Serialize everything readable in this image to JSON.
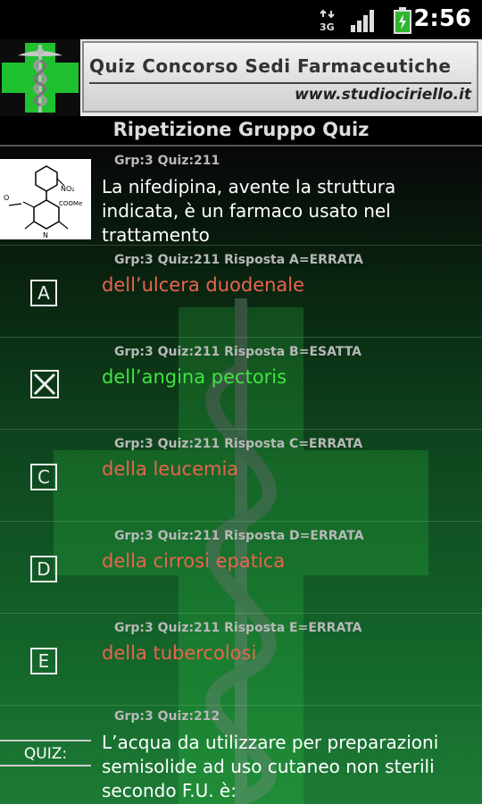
{
  "status_bar": {
    "time": "2:56",
    "network_label": "3G",
    "icons": [
      "3g-data-icon",
      "signal-icon",
      "battery-charging-icon"
    ]
  },
  "banner": {
    "title": "Quiz Concorso Sedi Farmaceutiche",
    "website": "www.studiociriello.it",
    "logo": "pharmacy-cross-caduceus-logo"
  },
  "header": {
    "title": "Ripetizione Gruppo Quiz"
  },
  "question_1": {
    "meta": "Grp:3  Quiz:211",
    "text": "La nifedipina, avente la struttura indicata, è un farmaco usato nel trattamento",
    "image": "nifedipine-structure"
  },
  "answers": [
    {
      "letter": "A",
      "meta": "Grp:3  Quiz:211  Risposta A=ERRATA",
      "text": "dell’ulcera duodenale",
      "correct": false
    },
    {
      "letter": "B",
      "meta": "Grp:3  Quiz:211  Risposta B=ESATTA",
      "text": "dell’angina pectoris",
      "correct": true
    },
    {
      "letter": "C",
      "meta": "Grp:3  Quiz:211  Risposta C=ERRATA",
      "text": "della leucemia",
      "correct": false
    },
    {
      "letter": "D",
      "meta": "Grp:3  Quiz:211  Risposta D=ERRATA",
      "text": "della cirrosi epatica",
      "correct": false
    },
    {
      "letter": "E",
      "meta": "Grp:3  Quiz:211  Risposta E=ERRATA",
      "text": "della tubercolosi",
      "correct": false
    }
  ],
  "question_2": {
    "meta": "Grp:3  Quiz:212",
    "label": "QUIZ:",
    "text": "L’acqua da utilizzare per preparazioni semisolide ad uso cutaneo non sterili secondo F.U. è:"
  },
  "colors": {
    "wrong": "#e8654f",
    "right": "#3fe63f",
    "green_cross": "#1fc12f"
  }
}
